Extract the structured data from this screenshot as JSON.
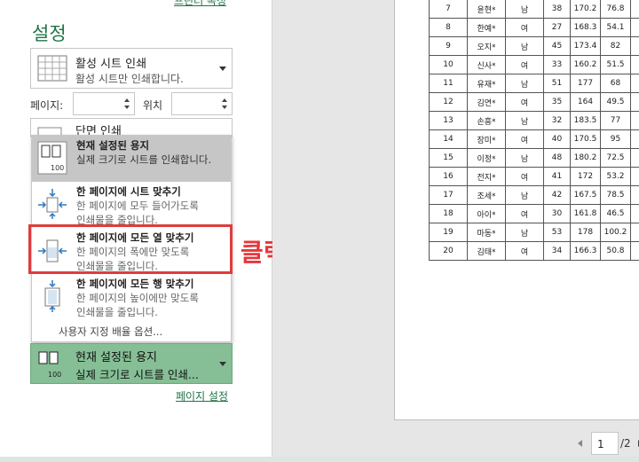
{
  "left_pane": {
    "printer_properties_link": "프린터 속성",
    "settings_title": "설정",
    "print_what": {
      "title": "활성 시트 인쇄",
      "desc": "활성 시트만 인쇄합니다."
    },
    "pages_label": "페이지:",
    "pages_from_value": "",
    "to_label": "위치",
    "pages_to_value": "",
    "duplex_title": "단면 인쇄",
    "scaling_options": [
      {
        "title": "현재 설정된 용지",
        "desc": [
          "실제 크기로 시트를 인쇄합니다."
        ],
        "icon": "actual-size-icon",
        "state": "selected"
      },
      {
        "title": "한 페이지에 시트 맞추기",
        "desc": [
          "한 페이지에 모두 들어가도록",
          "인쇄물을 줄입니다."
        ],
        "icon": "fit-sheet-icon"
      },
      {
        "title": "한 페이지에 모든 열 맞추기",
        "desc": [
          "한 페이지의 폭에만 맞도록",
          "인쇄물을 줄입니다."
        ],
        "icon": "fit-columns-icon"
      },
      {
        "title": "한 페이지에 모든 행 맞추기",
        "desc": [
          "한 페이지의 높이에만 맞도록",
          "인쇄물을 줄입니다."
        ],
        "icon": "fit-rows-icon"
      }
    ],
    "custom_scaling": "사용자 지정 배율 옵션...",
    "scaling_current": {
      "title": "현재 설정된 용지",
      "desc": "실제 크기로 시트를 인쇄..."
    },
    "page_setup_link": "페이지 설정"
  },
  "annotation": {
    "label": "클릭",
    "color": "#e8373b"
  },
  "preview": {
    "rows": [
      [
        "7",
        "윤현*",
        "남",
        "38",
        "170.2",
        "76.8",
        ""
      ],
      [
        "8",
        "한예*",
        "여",
        "27",
        "168.3",
        "54.1",
        ""
      ],
      [
        "9",
        "오지*",
        "남",
        "45",
        "173.4",
        "82",
        ""
      ],
      [
        "10",
        "신사*",
        "여",
        "33",
        "160.2",
        "51.5",
        ""
      ],
      [
        "11",
        "유재*",
        "남",
        "51",
        "177",
        "68",
        ""
      ],
      [
        "12",
        "김연*",
        "여",
        "35",
        "164",
        "49.5",
        ""
      ],
      [
        "13",
        "손흥*",
        "남",
        "32",
        "183.5",
        "77",
        ""
      ],
      [
        "14",
        "장미*",
        "여",
        "40",
        "170.5",
        "95",
        ""
      ],
      [
        "15",
        "이정*",
        "남",
        "48",
        "180.2",
        "72.5",
        ""
      ],
      [
        "16",
        "전지*",
        "여",
        "41",
        "172",
        "53.2",
        ""
      ],
      [
        "17",
        "조세*",
        "남",
        "42",
        "167.5",
        "78.5",
        ""
      ],
      [
        "18",
        "아이*",
        "여",
        "30",
        "161.8",
        "46.5",
        ""
      ],
      [
        "19",
        "마동*",
        "남",
        "53",
        "178",
        "100.2",
        ""
      ],
      [
        "20",
        "김태*",
        "여",
        "34",
        "166.3",
        "50.8",
        ""
      ]
    ],
    "page_current": "1",
    "page_total": "/2"
  },
  "colors": {
    "accent": "#217346",
    "scaling_selected_bg": "#86bf96",
    "option_selected_bg": "#c6c6c6"
  }
}
